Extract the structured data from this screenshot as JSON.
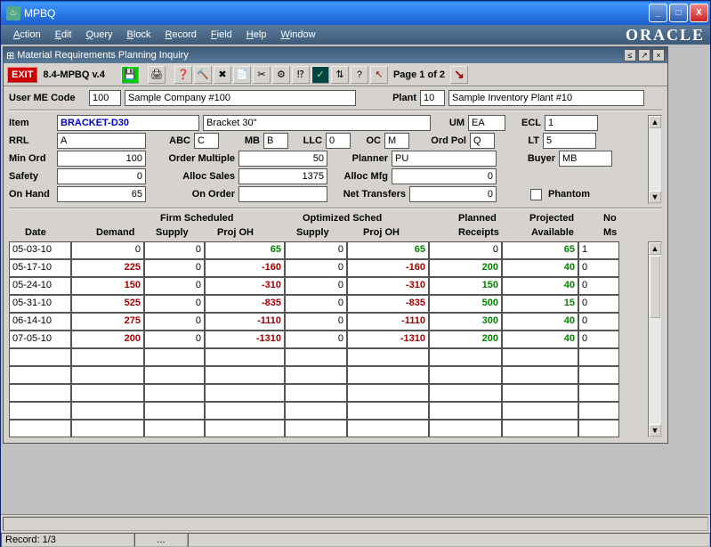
{
  "window": {
    "title": "MPBQ"
  },
  "menubar": [
    "Action",
    "Edit",
    "Query",
    "Block",
    "Record",
    "Field",
    "Help",
    "Window"
  ],
  "brand": "ORACLE",
  "inner": {
    "title": "Material Requirements Planning Inquiry"
  },
  "toolbar": {
    "exit": "EXIT",
    "version": "8.4-MPBQ v.4",
    "page": "Page 1 of 2"
  },
  "header": {
    "user_me_code_label": "User ME Code",
    "user_me_code": "100",
    "company": "Sample Company #100",
    "plant_label": "Plant",
    "plant": "10",
    "plant_name": "Sample Inventory Plant #10"
  },
  "item": {
    "item_label": "Item",
    "item": "BRACKET-D30",
    "desc": "Bracket 30\"",
    "um_label": "UM",
    "um": "EA",
    "ecl_label": "ECL",
    "ecl": "1",
    "rrl_label": "RRL",
    "rrl": "A",
    "abc_label": "ABC",
    "abc": "C",
    "mb_label": "MB",
    "mb": "B",
    "llc_label": "LLC",
    "llc": "0",
    "oc_label": "OC",
    "oc": "M",
    "ordpol_label": "Ord Pol",
    "ordpol": "Q",
    "lt_label": "LT",
    "lt": "5",
    "minord_label": "Min Ord",
    "minord": "100",
    "ordmult_label": "Order Multiple",
    "ordmult": "50",
    "planner_label": "Planner",
    "planner": "PU",
    "buyer_label": "Buyer",
    "buyer": "MB",
    "safety_label": "Safety",
    "safety": "0",
    "allocsales_label": "Alloc Sales",
    "allocsales": "1375",
    "allocmfg_label": "Alloc Mfg",
    "allocmfg": "0",
    "onhand_label": "On Hand",
    "onhand": "65",
    "onorder_label": "On Order",
    "onorder": "",
    "nettrans_label": "Net Transfers",
    "nettrans": "0",
    "phantom_label": "Phantom"
  },
  "grid": {
    "group_firm": "Firm Scheduled",
    "group_opt": "Optimized Sched",
    "col_date": "Date",
    "col_demand": "Demand",
    "col_supply": "Supply",
    "col_projoh": "Proj OH",
    "col_planned": "Planned",
    "col_receipts": "Receipts",
    "col_projected": "Projected",
    "col_available": "Available",
    "col_no": "No",
    "col_ms": "Ms",
    "rows": [
      {
        "date": "05-03-10",
        "demand": "0",
        "fsupply": "0",
        "fproj": "65",
        "osupply": "0",
        "oproj": "65",
        "planned": "0",
        "avail": "65",
        "noms": "1"
      },
      {
        "date": "05-17-10",
        "demand": "225",
        "fsupply": "0",
        "fproj": "-160",
        "osupply": "0",
        "oproj": "-160",
        "planned": "200",
        "avail": "40",
        "noms": "0"
      },
      {
        "date": "05-24-10",
        "demand": "150",
        "fsupply": "0",
        "fproj": "-310",
        "osupply": "0",
        "oproj": "-310",
        "planned": "150",
        "avail": "40",
        "noms": "0"
      },
      {
        "date": "05-31-10",
        "demand": "525",
        "fsupply": "0",
        "fproj": "-835",
        "osupply": "0",
        "oproj": "-835",
        "planned": "500",
        "avail": "15",
        "noms": "0"
      },
      {
        "date": "06-14-10",
        "demand": "275",
        "fsupply": "0",
        "fproj": "-1110",
        "osupply": "0",
        "oproj": "-1110",
        "planned": "300",
        "avail": "40",
        "noms": "0"
      },
      {
        "date": "07-05-10",
        "demand": "200",
        "fsupply": "0",
        "fproj": "-1310",
        "osupply": "0",
        "oproj": "-1310",
        "planned": "200",
        "avail": "40",
        "noms": "0"
      },
      {
        "date": "",
        "demand": "",
        "fsupply": "",
        "fproj": "",
        "osupply": "",
        "oproj": "",
        "planned": "",
        "avail": "",
        "noms": ""
      },
      {
        "date": "",
        "demand": "",
        "fsupply": "",
        "fproj": "",
        "osupply": "",
        "oproj": "",
        "planned": "",
        "avail": "",
        "noms": ""
      },
      {
        "date": "",
        "demand": "",
        "fsupply": "",
        "fproj": "",
        "osupply": "",
        "oproj": "",
        "planned": "",
        "avail": "",
        "noms": ""
      },
      {
        "date": "",
        "demand": "",
        "fsupply": "",
        "fproj": "",
        "osupply": "",
        "oproj": "",
        "planned": "",
        "avail": "",
        "noms": ""
      },
      {
        "date": "",
        "demand": "",
        "fsupply": "",
        "fproj": "",
        "osupply": "",
        "oproj": "",
        "planned": "",
        "avail": "",
        "noms": ""
      }
    ]
  },
  "statusbar": {
    "record": "Record: 1/3",
    "dots": "..."
  }
}
